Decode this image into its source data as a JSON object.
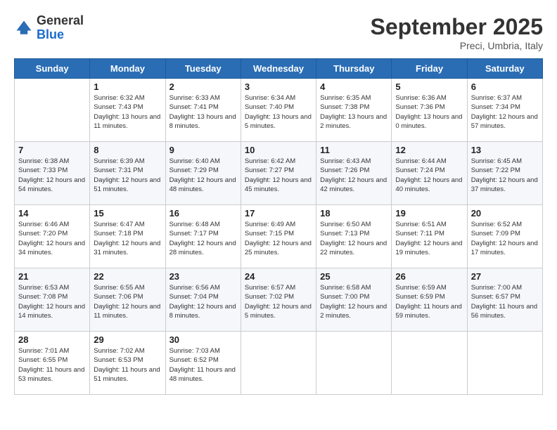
{
  "header": {
    "logo_general": "General",
    "logo_blue": "Blue",
    "month_title": "September 2025",
    "subtitle": "Preci, Umbria, Italy"
  },
  "days_of_week": [
    "Sunday",
    "Monday",
    "Tuesday",
    "Wednesday",
    "Thursday",
    "Friday",
    "Saturday"
  ],
  "weeks": [
    [
      {
        "day": "",
        "info": ""
      },
      {
        "day": "1",
        "info": "Sunrise: 6:32 AM\nSunset: 7:43 PM\nDaylight: 13 hours\nand 11 minutes."
      },
      {
        "day": "2",
        "info": "Sunrise: 6:33 AM\nSunset: 7:41 PM\nDaylight: 13 hours\nand 8 minutes."
      },
      {
        "day": "3",
        "info": "Sunrise: 6:34 AM\nSunset: 7:40 PM\nDaylight: 13 hours\nand 5 minutes."
      },
      {
        "day": "4",
        "info": "Sunrise: 6:35 AM\nSunset: 7:38 PM\nDaylight: 13 hours\nand 2 minutes."
      },
      {
        "day": "5",
        "info": "Sunrise: 6:36 AM\nSunset: 7:36 PM\nDaylight: 13 hours\nand 0 minutes."
      },
      {
        "day": "6",
        "info": "Sunrise: 6:37 AM\nSunset: 7:34 PM\nDaylight: 12 hours\nand 57 minutes."
      }
    ],
    [
      {
        "day": "7",
        "info": "Sunrise: 6:38 AM\nSunset: 7:33 PM\nDaylight: 12 hours\nand 54 minutes."
      },
      {
        "day": "8",
        "info": "Sunrise: 6:39 AM\nSunset: 7:31 PM\nDaylight: 12 hours\nand 51 minutes."
      },
      {
        "day": "9",
        "info": "Sunrise: 6:40 AM\nSunset: 7:29 PM\nDaylight: 12 hours\nand 48 minutes."
      },
      {
        "day": "10",
        "info": "Sunrise: 6:42 AM\nSunset: 7:27 PM\nDaylight: 12 hours\nand 45 minutes."
      },
      {
        "day": "11",
        "info": "Sunrise: 6:43 AM\nSunset: 7:26 PM\nDaylight: 12 hours\nand 42 minutes."
      },
      {
        "day": "12",
        "info": "Sunrise: 6:44 AM\nSunset: 7:24 PM\nDaylight: 12 hours\nand 40 minutes."
      },
      {
        "day": "13",
        "info": "Sunrise: 6:45 AM\nSunset: 7:22 PM\nDaylight: 12 hours\nand 37 minutes."
      }
    ],
    [
      {
        "day": "14",
        "info": "Sunrise: 6:46 AM\nSunset: 7:20 PM\nDaylight: 12 hours\nand 34 minutes."
      },
      {
        "day": "15",
        "info": "Sunrise: 6:47 AM\nSunset: 7:18 PM\nDaylight: 12 hours\nand 31 minutes."
      },
      {
        "day": "16",
        "info": "Sunrise: 6:48 AM\nSunset: 7:17 PM\nDaylight: 12 hours\nand 28 minutes."
      },
      {
        "day": "17",
        "info": "Sunrise: 6:49 AM\nSunset: 7:15 PM\nDaylight: 12 hours\nand 25 minutes."
      },
      {
        "day": "18",
        "info": "Sunrise: 6:50 AM\nSunset: 7:13 PM\nDaylight: 12 hours\nand 22 minutes."
      },
      {
        "day": "19",
        "info": "Sunrise: 6:51 AM\nSunset: 7:11 PM\nDaylight: 12 hours\nand 19 minutes."
      },
      {
        "day": "20",
        "info": "Sunrise: 6:52 AM\nSunset: 7:09 PM\nDaylight: 12 hours\nand 17 minutes."
      }
    ],
    [
      {
        "day": "21",
        "info": "Sunrise: 6:53 AM\nSunset: 7:08 PM\nDaylight: 12 hours\nand 14 minutes."
      },
      {
        "day": "22",
        "info": "Sunrise: 6:55 AM\nSunset: 7:06 PM\nDaylight: 12 hours\nand 11 minutes."
      },
      {
        "day": "23",
        "info": "Sunrise: 6:56 AM\nSunset: 7:04 PM\nDaylight: 12 hours\nand 8 minutes."
      },
      {
        "day": "24",
        "info": "Sunrise: 6:57 AM\nSunset: 7:02 PM\nDaylight: 12 hours\nand 5 minutes."
      },
      {
        "day": "25",
        "info": "Sunrise: 6:58 AM\nSunset: 7:00 PM\nDaylight: 12 hours\nand 2 minutes."
      },
      {
        "day": "26",
        "info": "Sunrise: 6:59 AM\nSunset: 6:59 PM\nDaylight: 11 hours\nand 59 minutes."
      },
      {
        "day": "27",
        "info": "Sunrise: 7:00 AM\nSunset: 6:57 PM\nDaylight: 11 hours\nand 56 minutes."
      }
    ],
    [
      {
        "day": "28",
        "info": "Sunrise: 7:01 AM\nSunset: 6:55 PM\nDaylight: 11 hours\nand 53 minutes."
      },
      {
        "day": "29",
        "info": "Sunrise: 7:02 AM\nSunset: 6:53 PM\nDaylight: 11 hours\nand 51 minutes."
      },
      {
        "day": "30",
        "info": "Sunrise: 7:03 AM\nSunset: 6:52 PM\nDaylight: 11 hours\nand 48 minutes."
      },
      {
        "day": "",
        "info": ""
      },
      {
        "day": "",
        "info": ""
      },
      {
        "day": "",
        "info": ""
      },
      {
        "day": "",
        "info": ""
      }
    ]
  ]
}
